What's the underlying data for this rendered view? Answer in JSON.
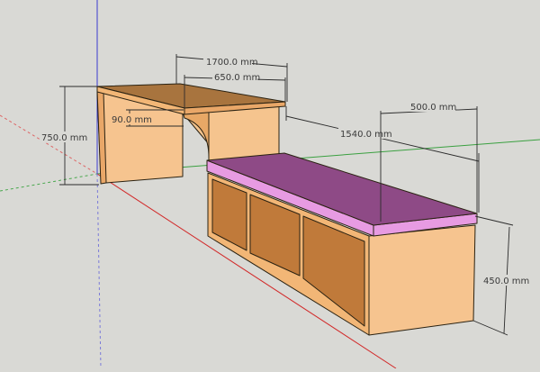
{
  "colors": {
    "background": "#d9d9d5",
    "axis_red": "#d22a2a",
    "axis_green": "#3aa040",
    "axis_blue": "#3b3bd0",
    "wood_light": "#f6c48f",
    "wood_face": "#f2b676",
    "wood_top": "#a8743e",
    "door_brown": "#c07a3a",
    "cushion_top": "#8e4a86",
    "cushion_side": "#e79be2"
  },
  "dimensions": {
    "overall_length": "1700.0 mm",
    "desk_width": "650.0 mm",
    "panel_thickness": "90.0 mm",
    "desk_height": "750.0 mm",
    "bench_length": "1540.0 mm",
    "bench_depth": "500.0 mm",
    "bench_height": "450.0 mm"
  }
}
